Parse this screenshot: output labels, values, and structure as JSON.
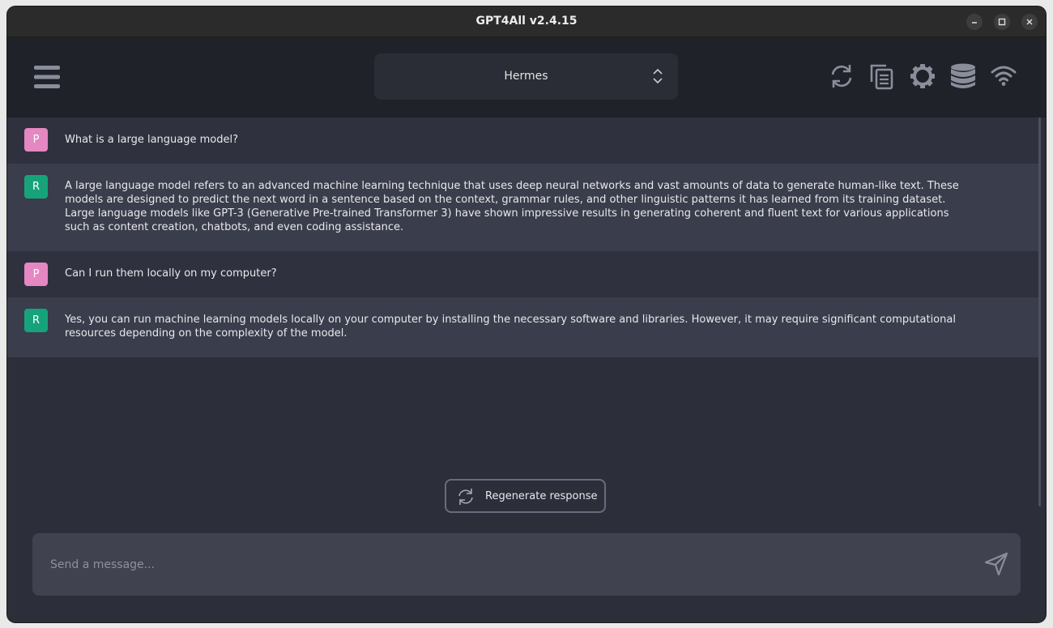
{
  "window": {
    "title": "GPT4All v2.4.15"
  },
  "toolbar": {
    "menu_icon": "hamburger-menu-icon",
    "model": {
      "selected": "Hermes"
    },
    "icons": [
      "reset-chat-icon",
      "copy-chat-icon",
      "settings-gear-icon",
      "database-icon",
      "network-wifi-icon"
    ]
  },
  "chat": {
    "messages": [
      {
        "role": "prompt",
        "avatar": "P",
        "text": "What is a large language model?"
      },
      {
        "role": "response",
        "avatar": "R",
        "text": "A large language model refers to an advanced machine learning technique that uses deep neural networks and vast amounts of data to generate human-like text. These models are designed to predict the next word in a sentence based on the context, grammar rules, and other linguistic patterns it has learned from its training dataset. Large language models like GPT-3 (Generative Pre-trained Transformer 3) have shown impressive results in generating coherent and fluent text for various applications such as content creation, chatbots, and even coding assistance."
      },
      {
        "role": "prompt",
        "avatar": "P",
        "text": "Can I run them locally on my computer?"
      },
      {
        "role": "response",
        "avatar": "R",
        "text": "Yes, you can run machine learning models locally on your computer by installing the necessary software and libraries. However, it may require significant computational resources depending on the complexity of the model."
      }
    ]
  },
  "regenerate": {
    "label": "Regenerate response"
  },
  "composer": {
    "placeholder": "Send a message..."
  },
  "colors": {
    "prompt_avatar": "#e487c2",
    "response_avatar": "#16a37b",
    "background": "#2c2e3a"
  }
}
